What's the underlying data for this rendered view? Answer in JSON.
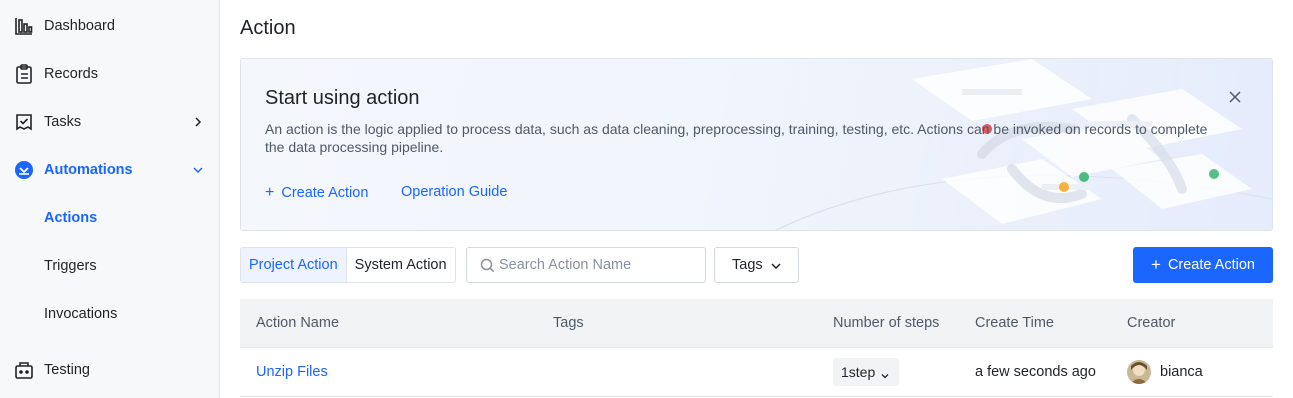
{
  "sidebar": {
    "items": [
      {
        "label": "Dashboard",
        "icon": "bar-chart-icon"
      },
      {
        "label": "Records",
        "icon": "clipboard-icon"
      },
      {
        "label": "Tasks",
        "icon": "task-icon"
      },
      {
        "label": "Automations",
        "icon": "automation-icon"
      },
      {
        "label": "Actions"
      },
      {
        "label": "Triggers"
      },
      {
        "label": "Invocations"
      },
      {
        "label": "Testing",
        "icon": "testing-icon"
      }
    ],
    "active_item": "Actions",
    "accent_color": "#1a66ff"
  },
  "page": {
    "title": "Action"
  },
  "banner": {
    "title": "Start using action",
    "description": "An action is the logic applied to process data, such as data cleaning, preprocessing, training, testing, etc. Actions can be invoked on records to complete the data processing pipeline.",
    "create_link": "Create Action",
    "guide_link": "Operation Guide"
  },
  "toolbar": {
    "tabs": [
      "Project Action",
      "System Action"
    ],
    "active_tab": "Project Action",
    "search_placeholder": "Search Action Name",
    "tags_label": "Tags",
    "create_button": "Create Action"
  },
  "table": {
    "columns": [
      "Action Name",
      "Tags",
      "Number of steps",
      "Create Time",
      "Creator"
    ],
    "rows": [
      {
        "name": "Unzip Files",
        "tags": "",
        "steps": "1step",
        "create_time": "a few seconds ago",
        "creator": "bianca"
      }
    ]
  }
}
